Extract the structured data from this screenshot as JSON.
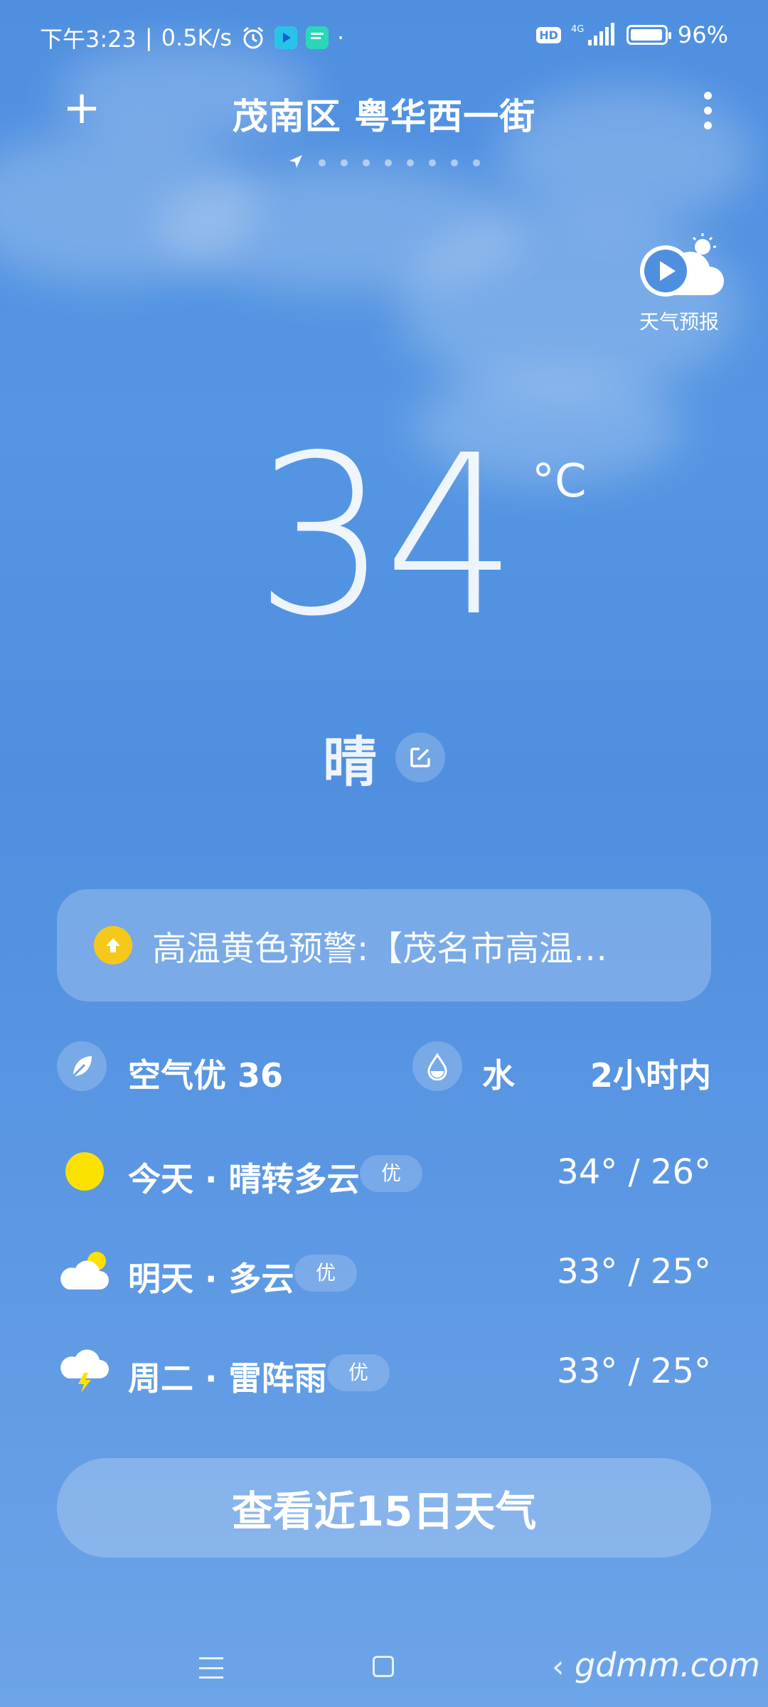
{
  "status_bar": {
    "time": "下午3:23",
    "separator": "|",
    "speed": "0.5K/s",
    "dot": "·",
    "hd": "HD",
    "network": "4G",
    "battery": "96%",
    "battery_level": 0.96
  },
  "header": {
    "add_label": "+",
    "location": "茂南区 粤华西一街",
    "page_count": 9,
    "active_page": 0
  },
  "video_forecast": {
    "label": "天气预报"
  },
  "current": {
    "temperature": "34",
    "unit": "°C",
    "condition": "晴"
  },
  "alert": {
    "text": "高温黄色预警:【茂名市高温…",
    "color": "#f7c81c"
  },
  "info_row": {
    "air_quality": "空气优 36",
    "rain_icon_label": "水",
    "rain_text": "2小时内"
  },
  "forecast": [
    {
      "label": "今天 · 晴转多云",
      "aqi": "优",
      "temp": "34° / 26°",
      "icon": "sun-icon"
    },
    {
      "label": "明天 · 多云",
      "aqi": "优",
      "temp": "33° / 25°",
      "icon": "cloudy-icon"
    },
    {
      "label": "周二 · 雷阵雨",
      "aqi": "优",
      "temp": "33° / 25°",
      "icon": "thunderstorm-icon"
    }
  ],
  "button_15": "查看近15日天气",
  "watermark": "gdmm.com",
  "nav": {
    "back": "‹"
  }
}
